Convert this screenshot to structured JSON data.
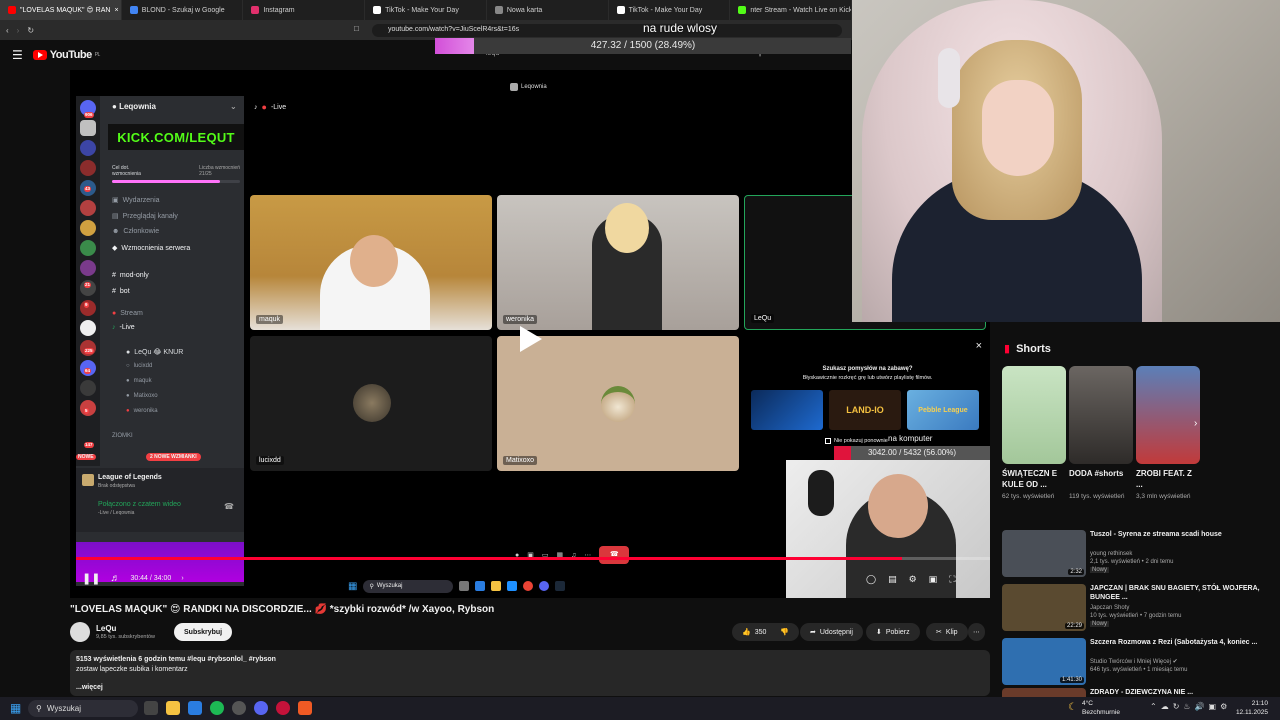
{
  "browser": {
    "tabs": [
      {
        "label": "\"LOVELAS MAQUK\" 😍 RAN",
        "color": "#ff0000",
        "active": true
      },
      {
        "label": "BLOND - Szukaj w Google",
        "color": "#4285f4",
        "active": false
      },
      {
        "label": "Instagram",
        "color": "#e1306c",
        "active": false
      },
      {
        "label": "TikTok - Make Your Day",
        "color": "#ffffff",
        "active": false
      },
      {
        "label": "Nowa karta",
        "color": "#888888",
        "active": false
      },
      {
        "label": "TikTok - Make Your Day",
        "color": "#ffffff",
        "active": false
      },
      {
        "label": "nter Stream - Watch Live on Kick",
        "color": "#53fc18",
        "active": false
      }
    ],
    "url": "youtube.com/watch?v=JiuScelR4rs&t=16s"
  },
  "overlay": {
    "title": "na rude wlosy",
    "progress_text": "427.32 / 1500 (28.49%)",
    "progress_fraction": 0.2849
  },
  "youtube": {
    "logo": "YouTube",
    "region": "PL",
    "search_value": "lequ"
  },
  "discord": {
    "server_name": "Leqownia",
    "kick_banner": "KICK.COM/LEQUT",
    "goal_label": "Cel dot.",
    "goal_sub": "wzmocnienia",
    "boost_label": "Liczba wzmocnień",
    "boost_value": "21/25",
    "channels": [
      "Wydarzenia",
      "Przeglądaj kanały",
      "Członkowie",
      "Wzmocnienia serwera",
      "mod-only",
      "bot",
      "Stream",
      "-Live"
    ],
    "voice_users": [
      "LeQu 😂 KNUR",
      "lucixdd",
      "maquk",
      "Matixoxo",
      "weronika"
    ],
    "category": "ZIOMKI",
    "new_badge": "NOWE",
    "boost_badge": "2 NOWE WZMIANKI",
    "activity_game": "League of Legends",
    "activity_sub": "Brak odstępstwa",
    "connected": "Połączono z czatem wideo",
    "connected_sub": "-Live / Leqownia",
    "call_header": "-Live",
    "call_server": "Leqownia",
    "guild_badges": [
      "906",
      "43",
      "21",
      "9",
      "225",
      "64",
      "5",
      "147"
    ],
    "participants": [
      {
        "name": "maquk"
      },
      {
        "name": "weronika"
      },
      {
        "name": "LeQu"
      },
      {
        "name": "lucixdd"
      },
      {
        "name": "Matixoxo"
      }
    ]
  },
  "player": {
    "time": "30:44 / 34:00",
    "progress_fraction": 0.904,
    "endscreen_prompt": "Szukasz pomysłów na zabawę?",
    "endscreen_sub": "Błyskawicznie rozkręć grę lub utwórz playlistę filmów.",
    "endscreen_games": [
      "",
      "LAND-IO",
      "Pebble League"
    ],
    "dont_show": "Nie pokazuj ponownie",
    "inner_search": "Wyszukaj",
    "overlay2_title": "na komputer",
    "overlay2_progress": "3042.00 / 5432 (56.00%)",
    "overlay2_fraction": 0.56
  },
  "shorts": {
    "title": "Shorts",
    "items": [
      {
        "title": "ŚWIĄTECZN E KULE OD ...",
        "views": "62 tys. wyświetleń"
      },
      {
        "title": "DODA #shorts",
        "views": "119 tys. wyświetleń"
      },
      {
        "title": "ZROBI FEAT. Z ...",
        "views": "3,3 mln wyświetleń"
      }
    ]
  },
  "related": [
    {
      "title": "Tuszol - Syrena ze streama scadi house",
      "channel": "young rethinsek",
      "meta": "2,1 tys. wyświetleń • 2 dni temu",
      "badge": "Nowy",
      "duration": "2:32",
      "color": "#4a4f57"
    },
    {
      "title": "JAPCZAN | BRAK SNU BAGIETY, STÓŁ WOJFERA, BUNGEE ...",
      "channel": "Japczan Shoty",
      "meta": "10 tys. wyświetleń • 7 godzin temu",
      "badge": "Nowy",
      "duration": "22:29",
      "color": "#5a4a30"
    },
    {
      "title": "Szczera Rozmowa z Rezi (Sabotażysta 4, koniec ...",
      "channel": "Studio Twórców i Mniej Więcej ✔",
      "meta": "646 tys. wyświetleń • 1 miesiąc temu",
      "badge": "",
      "duration": "1:41:30",
      "color": "#2f6fb0"
    },
    {
      "title": "ZDRADY - DZIEWCZYNA NIE ...",
      "channel": "",
      "meta": "",
      "badge": "",
      "duration": "",
      "color": "#6a3b2a"
    }
  ],
  "video": {
    "title": "\"LOVELAS MAQUK\" 😍 RANDKI NA DISCORDZIE... 💋 *szybki rozwód* /w Xayoo, Rybson",
    "channel": "LeQu",
    "subs": "9,85 tys. subskrybentów",
    "subscribe": "Subskrybuj",
    "likes": "350",
    "share": "Udostępnij",
    "download": "Pobierz",
    "clip": "Klip",
    "views_line": "5153 wyświetlenia  6 godzin temu  #lequ #rybsonlol_ #rybson",
    "desc_line": "zostaw lapeczke subika i komentarz",
    "more": "...więcej"
  },
  "taskbar": {
    "search": "Wyszukaj",
    "temp": "4°C",
    "weather": "Bezchmurnie",
    "time": "21:10",
    "date": "12.11.2025"
  }
}
